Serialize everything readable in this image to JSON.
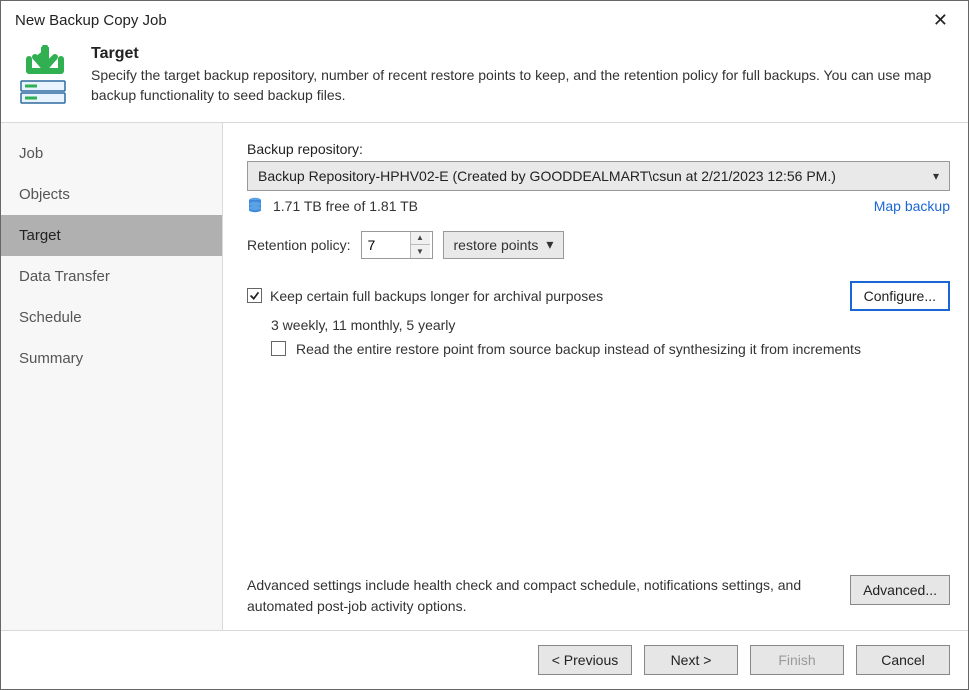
{
  "window": {
    "title": "New Backup Copy Job"
  },
  "header": {
    "heading": "Target",
    "desc": "Specify the target backup repository, number of recent restore points to keep, and the retention policy for full backups. You can use map backup functionality to seed backup files."
  },
  "sidebar": {
    "items": [
      {
        "label": "Job"
      },
      {
        "label": "Objects"
      },
      {
        "label": "Target"
      },
      {
        "label": "Data Transfer"
      },
      {
        "label": "Schedule"
      },
      {
        "label": "Summary"
      }
    ],
    "selected_index": 2
  },
  "repo": {
    "label": "Backup repository:",
    "selected": "Backup Repository-HPHV02-E (Created by GOODDEALMART\\csun at 2/21/2023 12:56 PM.)",
    "free_text": "1.71 TB free of 1.81 TB",
    "map_link": "Map backup"
  },
  "retention": {
    "label": "Retention policy:",
    "value": "7",
    "unit": "restore points"
  },
  "keep": {
    "checked": true,
    "label": "Keep certain full backups longer for archival purposes",
    "configure_label": "Configure...",
    "summary": "3 weekly, 11 monthly, 5 yearly",
    "read_checked": false,
    "read_label": "Read the entire restore point from source backup instead of synthesizing it from increments"
  },
  "advanced": {
    "text": "Advanced settings include health check and compact schedule, notifications settings, and automated post-job activity options.",
    "button": "Advanced..."
  },
  "footer": {
    "previous": "< Previous",
    "next": "Next >",
    "finish": "Finish",
    "cancel": "Cancel"
  }
}
